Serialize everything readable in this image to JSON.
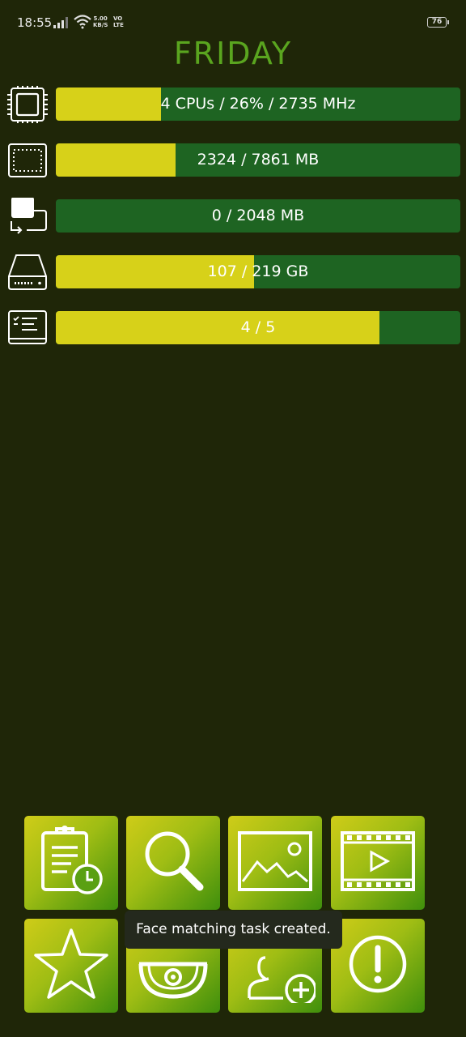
{
  "status_bar": {
    "time": "18:55",
    "net_speed_value": "5.00",
    "net_speed_unit": "KB/S",
    "volte_top": "VO",
    "volte_bottom": "LTE",
    "battery": "76"
  },
  "header": {
    "title": "FRIDAY"
  },
  "stats": [
    {
      "icon": "cpu-icon",
      "label": "4 CPUs / 26% / 2735 MHz",
      "fill_percent": 26
    },
    {
      "icon": "memory-icon",
      "label": "2324 / 7861 MB",
      "fill_percent": 29.6
    },
    {
      "icon": "swap-icon",
      "label": "0 / 2048 MB",
      "fill_percent": 0
    },
    {
      "icon": "storage-icon",
      "label": "107 / 219 GB",
      "fill_percent": 48.9
    },
    {
      "icon": "tasks-icon",
      "label": "4 / 5",
      "fill_percent": 80
    }
  ],
  "tiles": [
    {
      "icon": "task-history-icon"
    },
    {
      "icon": "search-icon"
    },
    {
      "icon": "image-icon"
    },
    {
      "icon": "video-icon"
    },
    {
      "icon": "star-icon"
    },
    {
      "icon": "camera-icon"
    },
    {
      "icon": "add-person-icon"
    },
    {
      "icon": "alert-icon"
    }
  ],
  "toast": {
    "message": "Face matching task created."
  },
  "colors": {
    "background": "#1f2608",
    "title": "#5aa51f",
    "bar_track": "#1e6422",
    "bar_fill": "#d7d119"
  }
}
